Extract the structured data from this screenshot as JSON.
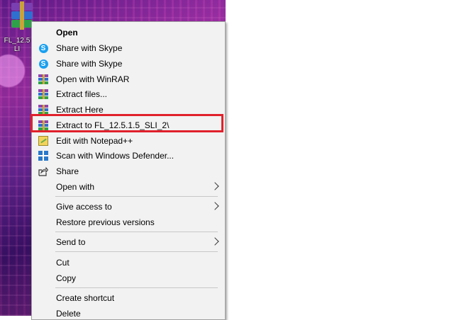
{
  "desktop": {
    "file_label": "FL_12.5\nLI"
  },
  "menu": {
    "open": "Open",
    "share_skype_1": "Share with Skype",
    "share_skype_2": "Share with Skype",
    "open_winrar": "Open with WinRAR",
    "extract_files": "Extract files...",
    "extract_here": "Extract Here",
    "extract_to": "Extract to FL_12.5.1.5_SLI_2\\",
    "edit_notepad": "Edit with Notepad++",
    "scan_defender": "Scan with Windows Defender...",
    "share": "Share",
    "open_with": "Open with",
    "give_access": "Give access to",
    "restore_versions": "Restore previous versions",
    "send_to": "Send to",
    "cut": "Cut",
    "copy": "Copy",
    "create_shortcut": "Create shortcut",
    "delete": "Delete"
  },
  "colors": {
    "highlight": "#e0212b",
    "menu_bg": "#f2f2f2"
  },
  "icons": {
    "skype": "skype-icon",
    "winrar": "winrar-icon",
    "notepad": "notepad-plus-plus-icon",
    "defender": "windows-defender-icon",
    "share": "share-icon",
    "submenu": "chevron-right-icon"
  }
}
